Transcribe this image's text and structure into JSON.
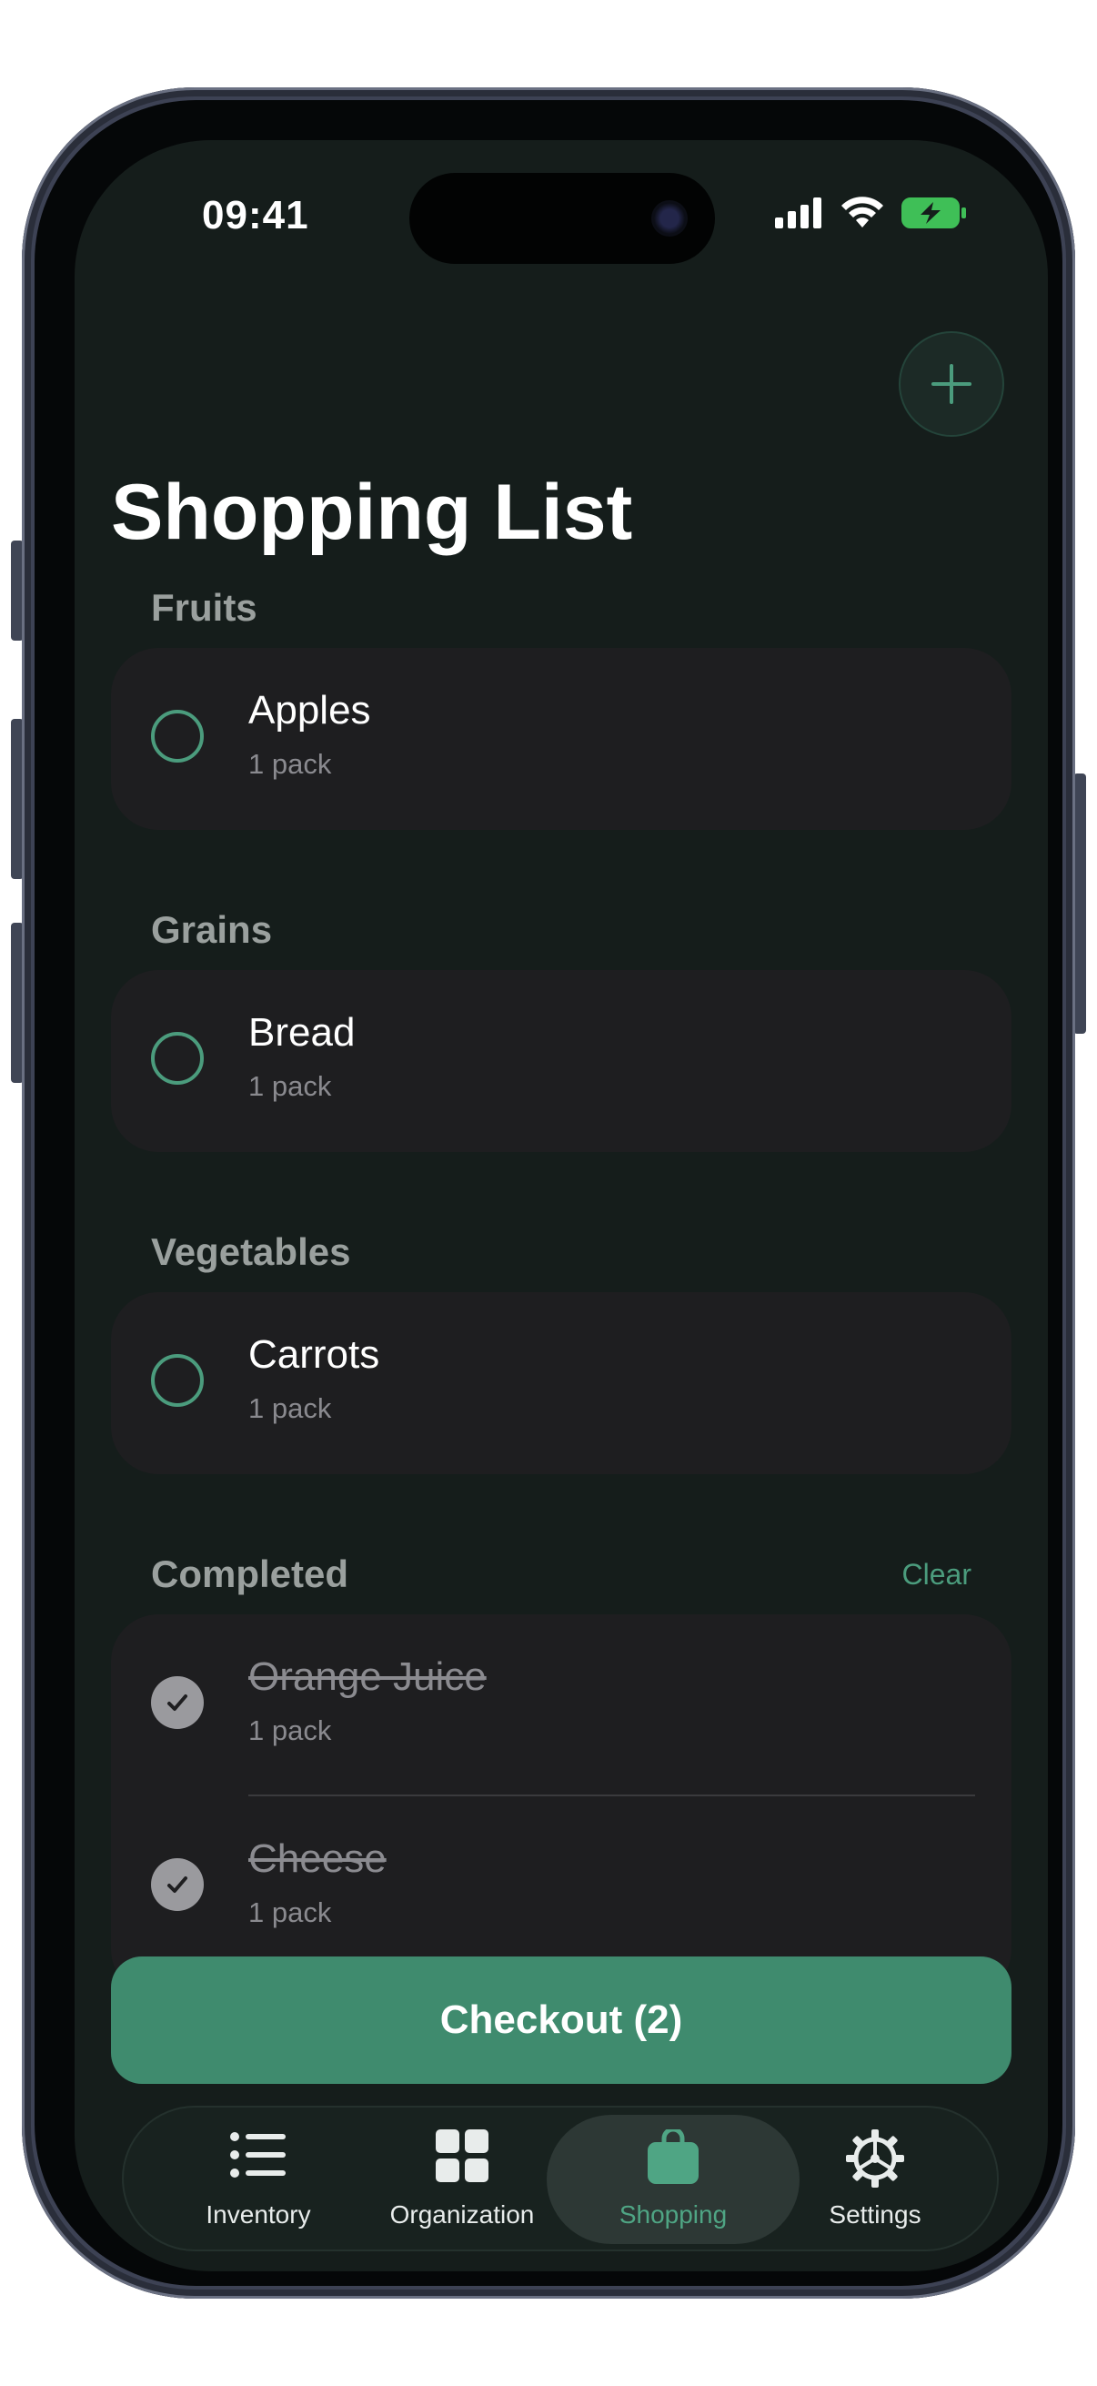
{
  "status_bar": {
    "time": "09:41",
    "icons": [
      "signal-icon",
      "wifi-icon",
      "battery-charging-icon"
    ]
  },
  "header": {
    "title": "Shopping List",
    "add_icon": "plus-icon"
  },
  "sections": [
    {
      "title": "Fruits",
      "items": [
        {
          "name": "Apples",
          "quantity": "1 pack",
          "checked": false
        }
      ]
    },
    {
      "title": "Grains",
      "items": [
        {
          "name": "Bread",
          "quantity": "1 pack",
          "checked": false
        }
      ]
    },
    {
      "title": "Vegetables",
      "items": [
        {
          "name": "Carrots",
          "quantity": "1 pack",
          "checked": false
        }
      ]
    }
  ],
  "completed": {
    "title": "Completed",
    "clear_label": "Clear",
    "items": [
      {
        "name": "Orange Juice",
        "quantity": "1 pack",
        "checked": true
      },
      {
        "name": "Cheese",
        "quantity": "1 pack",
        "checked": true
      }
    ]
  },
  "checkout_label": "Checkout (2)",
  "tabs": [
    {
      "label": "Inventory",
      "icon": "list-icon",
      "active": false
    },
    {
      "label": "Organization",
      "icon": "grid-icon",
      "active": false
    },
    {
      "label": "Shopping",
      "icon": "bag-icon",
      "active": true
    },
    {
      "label": "Settings",
      "icon": "gear-icon",
      "active": false
    }
  ],
  "colors": {
    "accent": "#4b9c7d",
    "button": "#3f8b6e",
    "background": "#151d1b",
    "card": "#1e1e20"
  }
}
